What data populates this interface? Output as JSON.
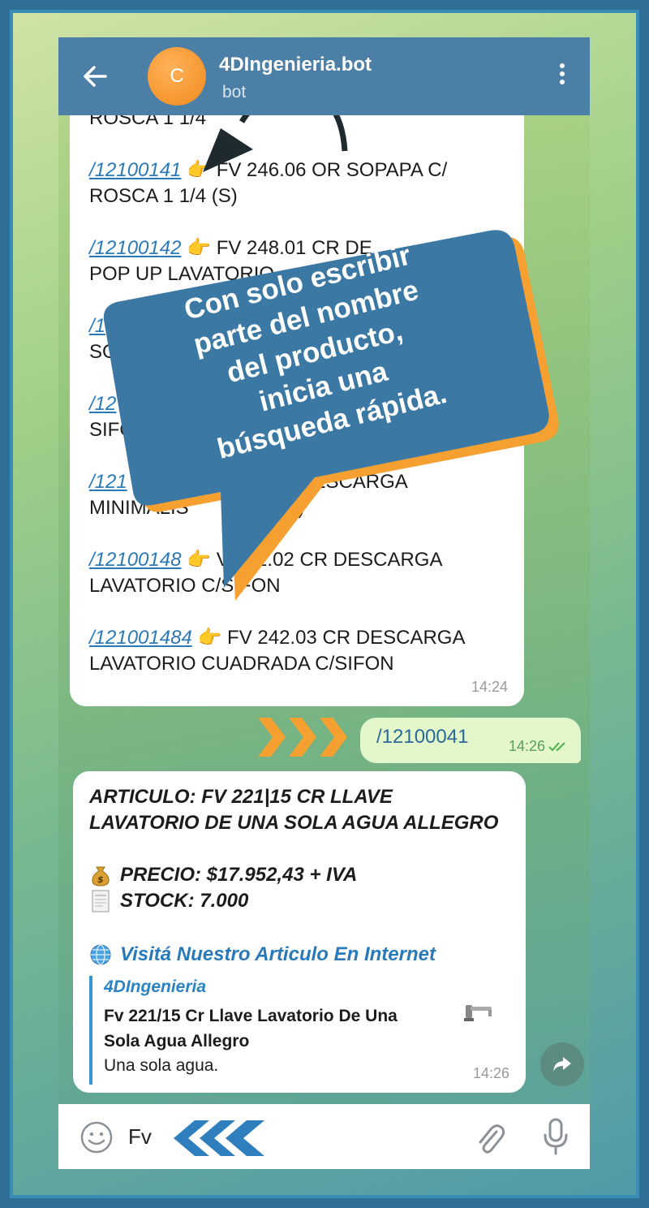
{
  "header": {
    "avatar_letter": "C",
    "title": "4DIngenieria.bot",
    "subtitle": "bot"
  },
  "bot_list_message": {
    "partial_top_line": "ROSCA 1 1/4",
    "items": [
      {
        "command": "/12100141",
        "emoji": "👉",
        "text": "FV 246.06 OR SOPAPA C/",
        "text2": "ROSCA 1 1/4 (S)"
      },
      {
        "command": "/12100142",
        "emoji": "👉",
        "text": "FV 248.01 CR DE",
        "text2": "POP UP LAVATORIO"
      },
      {
        "command": "/1",
        "emoji": "",
        "text": "",
        "text2": "SO"
      },
      {
        "command": "/12",
        "emoji": "",
        "text": "",
        "text2": "SIFO"
      },
      {
        "command": "/121",
        "emoji": "",
        "text": "2.01 CR DESCARGA",
        "text2": "MINIMALIS        FON (S)"
      },
      {
        "command": "/12100148",
        "emoji": "👉",
        "text": "V 242.02 CR DESCARGA",
        "text2": "LAVATORIO C/SIFON"
      },
      {
        "command": "/121001484",
        "emoji": "👉",
        "text": "FV 242.03 CR DESCARGA",
        "text2": "LAVATORIO CUADRADA C/SIFON"
      }
    ],
    "time": "14:24"
  },
  "user_message": {
    "text": "/12100041",
    "time": "14:26"
  },
  "article_message": {
    "title_line1": "ARTICULO: FV 221|15 CR LLAVE",
    "title_line2": "LAVATORIO DE UNA SOLA AGUA ALLEGRO",
    "price": "PRECIO: $17.952,43 + IVA",
    "stock": "STOCK: 7.000",
    "link_label": "Visitá Nuestro Articulo En Internet",
    "preview": {
      "site": "4DIngenieria",
      "title": "Fv 221/15 Cr Llave Lavatorio De Una Sola Agua Allegro",
      "description": "Una sola agua."
    },
    "time": "14:26",
    "icons": {
      "price": "money-bag-icon",
      "stock": "receipt-icon",
      "link": "globe-icon"
    }
  },
  "input_bar": {
    "value": "Fv"
  },
  "callout": {
    "line1": "Con solo escribir",
    "line2": "parte del nombre",
    "line3": "del producto,",
    "line4": "inicia una",
    "line5": "búsqueda rápida."
  },
  "colors": {
    "header": "#4c7fa6",
    "link": "#2a79b8",
    "callout_fill": "#3b78a3",
    "callout_shadow": "#f5a030",
    "arrow_orange": "#f5a030",
    "arrow_blue": "#2f7fbf"
  }
}
